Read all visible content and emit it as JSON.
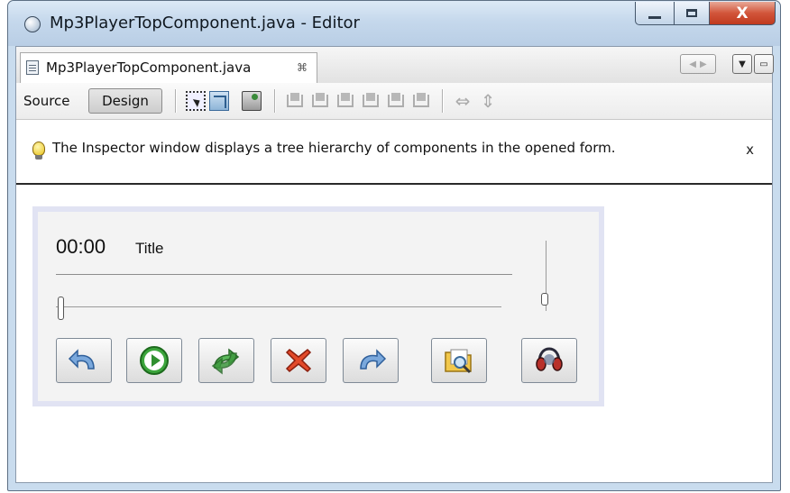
{
  "window": {
    "title": "Mp3PlayerTopComponent.java - Editor",
    "close_glyph": "X"
  },
  "editor_tab": {
    "label": "Mp3PlayerTopComponent.java",
    "close_glyph": "⌘"
  },
  "toolbar": {
    "source_label": "Source",
    "design_label": "Design",
    "icons": [
      "selection-mode-icon",
      "connection-mode-icon",
      "preview-design-icon",
      "align-left-icon",
      "align-right-icon",
      "center-horizontally-icon",
      "align-top-icon",
      "align-bottom-icon",
      "center-vertically-icon",
      "horizontal-resize-icon",
      "vertical-resize-icon"
    ]
  },
  "hint": {
    "text": "The Inspector window displays a tree hierarchy of components in the opened form.",
    "close_label": "x"
  },
  "player": {
    "time": "00:00",
    "title": "Title",
    "position_fraction": 0.0,
    "volume_fraction": 0.0,
    "buttons": [
      "back-icon",
      "play-icon",
      "shuffle-icon",
      "stop-icon",
      "forward-icon",
      "open-folder-icon",
      "headphones-icon"
    ]
  },
  "colors": {
    "title_bar": "#c5d8ec",
    "close_button": "#c9442a",
    "form_border": "#e1e3f3"
  }
}
